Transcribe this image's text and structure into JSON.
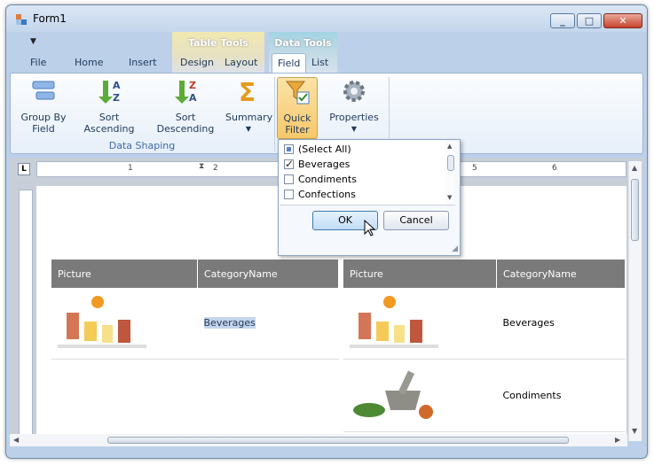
{
  "window": {
    "title": "Form1",
    "minimize_glyph": "_",
    "maximize_glyph": "□",
    "close_glyph": "✕"
  },
  "qat": {
    "glyph": "▼"
  },
  "context_tabs": {
    "table_tools": "Table Tools",
    "data_tools": "Data Tools"
  },
  "tabs": [
    "File",
    "Home",
    "Insert",
    "Design",
    "Layout",
    "Field",
    "List"
  ],
  "active_tab": "Field",
  "ribbon": {
    "buttons": [
      {
        "label": "Group By\nField",
        "icon": "group-by-field-icon"
      },
      {
        "label": "Sort Ascending",
        "icon": "sort-ascending-icon"
      },
      {
        "label": "Sort Descending",
        "icon": "sort-descending-icon"
      },
      {
        "label": "Summary",
        "icon": "summary-sigma-icon"
      },
      {
        "label": "Quick\nFilter",
        "icon": "quick-filter-icon"
      },
      {
        "label": "Properties",
        "icon": "gear-icon"
      }
    ],
    "group_label": "Data Shaping"
  },
  "ruler": {
    "corner": "L",
    "numbers": [
      "1",
      "2",
      "5",
      "6"
    ]
  },
  "quick_filter_popup": {
    "items": [
      {
        "label": "(Select All)",
        "state": "partial"
      },
      {
        "label": "Beverages",
        "state": "checked"
      },
      {
        "label": "Condiments",
        "state": "unchecked"
      },
      {
        "label": "Confections",
        "state": "unchecked"
      }
    ],
    "ok_label": "OK",
    "cancel_label": "Cancel"
  },
  "tables": {
    "left": {
      "columns": [
        "Picture",
        "CategoryName"
      ],
      "rows": [
        {
          "picture": "beverages-image",
          "category": "Beverages"
        }
      ]
    },
    "right": {
      "columns": [
        "Picture",
        "CategoryName"
      ],
      "rows": [
        {
          "picture": "beverages-image",
          "category": "Beverages"
        },
        {
          "picture": "condiments-image",
          "category": "Condiments"
        }
      ]
    }
  },
  "colors": {
    "header_bg": "#7a7a7a",
    "selection": "#c5d5ec",
    "accent": "#3e6aaa"
  }
}
